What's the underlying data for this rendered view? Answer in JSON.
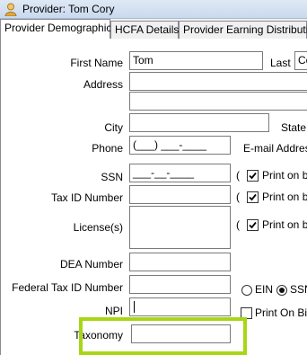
{
  "window": {
    "title": "Provider: Tom Cory",
    "icon": "person-icon"
  },
  "tabs": [
    {
      "label": "Provider Demographics",
      "active": true
    },
    {
      "label": "HCFA Details",
      "active": false
    },
    {
      "label": "Provider Earning Distribution",
      "active": false
    }
  ],
  "form": {
    "first_name_label": "First Name",
    "first_name_value": "Tom",
    "last_label": "Last",
    "last_value": "Co",
    "address_label": "Address",
    "address_line1": "",
    "address_line2": "",
    "city_label": "City",
    "city_value": "",
    "state_label": "State",
    "phone_label": "Phone",
    "phone_mask": "(___) ___-____",
    "email_label": "E-mail Address",
    "ssn_label": "SSN",
    "ssn_mask": "___-__-____",
    "taxid_label": "Tax ID Number",
    "taxid_value": "",
    "license_label": "License(s)",
    "license_value": "",
    "dea_label": "DEA Number",
    "dea_value": "",
    "fed_taxid_label": "Federal Tax ID Number",
    "fed_taxid_value": "",
    "npi_label": "NPI",
    "npi_value": "",
    "taxonomy_label": "Taxonomy",
    "taxonomy_value": ""
  },
  "options": {
    "paren": "(",
    "print_on_bill_label": "Print on bill",
    "print_on_bill_1": true,
    "print_on_bill_2": true,
    "print_on_bill_3": true,
    "ein_label": "EIN",
    "ssn_radio_label": "SSN",
    "selected_id_type": "SSN",
    "print_on_bills_label": "Print On Bills",
    "print_on_bills_checked": false
  },
  "colors": {
    "highlight": "#a8d616"
  }
}
